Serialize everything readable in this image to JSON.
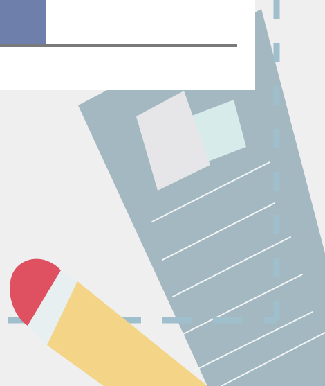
{
  "palette": {
    "background": "#efefef",
    "card": "#ffffff",
    "accent_block": "#6f7fab",
    "rule": "#7a7a7a",
    "document": "#a3b8c0",
    "document_photo_back": "#d7ebeb",
    "document_photo_front": "#e6e6e9",
    "document_lines": "#f2f5f6",
    "dashed_frame": "#a0bfcc",
    "pencil_eraser": "#df5061",
    "pencil_band": "#e8eff0",
    "pencil_body": "#f4d486"
  },
  "icons": {
    "document": "document-icon",
    "pencil": "pencil-icon",
    "photo": "photo-thumbnail-icon"
  }
}
